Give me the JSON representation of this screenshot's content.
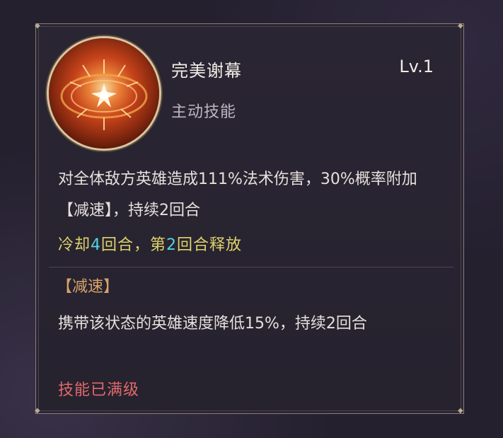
{
  "skill": {
    "name": "完美谢幕",
    "level": "Lv.1",
    "type": "主动技能",
    "icon": "burst-icon",
    "description": "对全体敌方英雄造成111%法术伤害，30%概率附加【减速】，持续2回合",
    "cooldown": {
      "prefix": "冷却",
      "turns": "4",
      "mid": "回合，第",
      "release_turn": "2",
      "suffix": "回合释放"
    },
    "effect": {
      "title": "【减速】",
      "description": "携带该状态的英雄速度降低15%，持续2回合"
    },
    "status": "技能已满级"
  },
  "colors": {
    "cooldown_text": "#ded36a",
    "cooldown_number": "#4fd6e0",
    "effect_title": "#d9a36a",
    "maxed_status": "#e06a6a"
  }
}
